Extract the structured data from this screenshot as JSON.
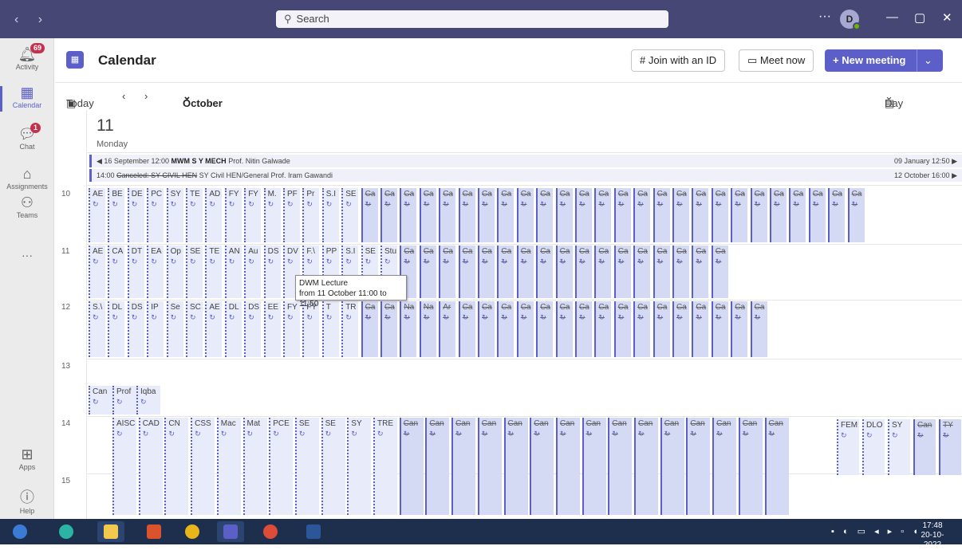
{
  "titlebar": {
    "nav_back": "‹",
    "nav_fwd": "›",
    "search_placeholder": "Search",
    "more": "···",
    "avatar_initial": "D",
    "min": "—",
    "max": "▢",
    "close": "✕"
  },
  "rail": {
    "activity": {
      "label": "Activity",
      "badge": "69"
    },
    "calendar": {
      "label": "Calendar"
    },
    "chat": {
      "label": "Chat",
      "badge": "1"
    },
    "assignments": {
      "label": "Assignments"
    },
    "teams": {
      "label": "Teams"
    },
    "more": "···",
    "apps": {
      "label": "Apps"
    },
    "help": {
      "label": "Help"
    }
  },
  "header": {
    "title": "Calendar",
    "join_id": "Join with an ID",
    "meet_now": "Meet now",
    "new_meeting": "New meeting"
  },
  "navrow": {
    "today": "Today",
    "month": "October 2021",
    "view": "Day"
  },
  "day": {
    "number": "11",
    "name": "Monday"
  },
  "allday": [
    {
      "left": "◀ 16 September 12:00",
      "title": "MWM S Y MECH",
      "organizer": "Prof. Nitin Galwade",
      "right": "09 January 12:50 ▶"
    },
    {
      "left": "14:00",
      "title": "Canceled: SY CIVIL HEN",
      "organizer": "SY Civil HEN/General  Prof. Iram Gawandi",
      "right": "12 October 16:00 ▶"
    }
  ],
  "hours": [
    "10",
    "11",
    "12",
    "13",
    "14",
    "15"
  ],
  "tooltip": {
    "title": "DWM Lecture",
    "time": "from 11 October 11:00 to 11:50"
  },
  "events": {
    "h10": [
      "AE",
      "BE",
      "DE",
      "PC",
      "SY",
      "TE",
      "AD",
      "FY",
      "FY",
      "M.",
      "PF",
      "Pr",
      "S.I",
      "SE",
      "Ca",
      "Ca",
      "Ca",
      "Ca",
      "Ca",
      "Ca",
      "Ca",
      "Ca",
      "Ca",
      "Ca",
      "Ca",
      "Ca",
      "Ca",
      "Ca",
      "Ca",
      "Ca",
      "Ca",
      "Ca",
      "Ca",
      "Ca",
      "Ca",
      "Ca",
      "Ca",
      "Ca",
      "Ca",
      "Ca"
    ],
    "h11": [
      "AE",
      "CA",
      "DT",
      "EA",
      "Op",
      "SE",
      "TE",
      "AN",
      "Au",
      "DS",
      "DV",
      "F.\\",
      "PP",
      "S.I",
      "SE",
      "Stu",
      "Ca",
      "Ca",
      "Ca",
      "Ca",
      "Ca",
      "Ca",
      "Ca",
      "Ca",
      "Ca",
      "Ca",
      "Ca",
      "Ca",
      "Ca",
      "Ca",
      "Ca",
      "Ca",
      "Ca"
    ],
    "h12": [
      "S.\\",
      "DL",
      "DS",
      "IP",
      "Se",
      "SC",
      "AE",
      "DL",
      "DS",
      "EE",
      "FY",
      "FY",
      "T",
      "TR",
      "Ca",
      "Ca",
      "Na",
      "Na",
      "Ar",
      "Ca",
      "Ca",
      "Ca",
      "Ca",
      "Ca",
      "Ca",
      "Ca",
      "Ca",
      "Ca",
      "Ca",
      "Ca",
      "Ca",
      "Ca",
      "Ca",
      "Ca",
      "Ca"
    ],
    "h14": [
      "AISC",
      "CAD",
      "CN",
      "CSS",
      "Mac",
      "Mat",
      "PCE",
      "SE",
      "SE",
      "SY",
      "TRE",
      "Can",
      "Can",
      "Can",
      "Can",
      "Can",
      "Can",
      "Can",
      "Can",
      "Can",
      "Can",
      "Can",
      "Can",
      "Can",
      "Can",
      "Can"
    ],
    "h14b": [
      "FEM",
      "DLO",
      "SY",
      "Can",
      "TY"
    ],
    "h13": [
      "Can",
      "Prof",
      "Iqba"
    ]
  },
  "taskbar": {
    "time": "17:48",
    "date": "20-10-2022"
  }
}
